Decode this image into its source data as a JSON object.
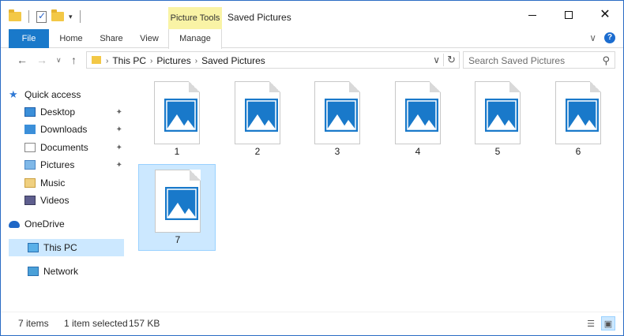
{
  "window": {
    "title": "Saved Pictures",
    "context_tab": "Picture Tools"
  },
  "ribbon": {
    "tabs": [
      "File",
      "Home",
      "Share",
      "View",
      "Manage"
    ]
  },
  "address": {
    "crumbs": [
      "This PC",
      "Pictures",
      "Saved Pictures"
    ],
    "search_placeholder": "Search Saved Pictures"
  },
  "nav": {
    "quick_access": "Quick access",
    "items": [
      {
        "label": "Desktop",
        "pinned": true
      },
      {
        "label": "Downloads",
        "pinned": true
      },
      {
        "label": "Documents",
        "pinned": true
      },
      {
        "label": "Pictures",
        "pinned": true
      },
      {
        "label": "Music",
        "pinned": false
      },
      {
        "label": "Videos",
        "pinned": false
      }
    ],
    "onedrive": "OneDrive",
    "thispc": "This PC",
    "network": "Network"
  },
  "files": [
    {
      "name": "1",
      "selected": false
    },
    {
      "name": "2",
      "selected": false
    },
    {
      "name": "3",
      "selected": false
    },
    {
      "name": "4",
      "selected": false
    },
    {
      "name": "5",
      "selected": false
    },
    {
      "name": "6",
      "selected": false
    },
    {
      "name": "7",
      "selected": true
    }
  ],
  "status": {
    "count": "7 items",
    "selection": "1 item selected",
    "size": "157 KB"
  },
  "colors": {
    "accent": "#1979ca",
    "selection": "#cce8ff",
    "context_tab": "#f9f3a5"
  }
}
